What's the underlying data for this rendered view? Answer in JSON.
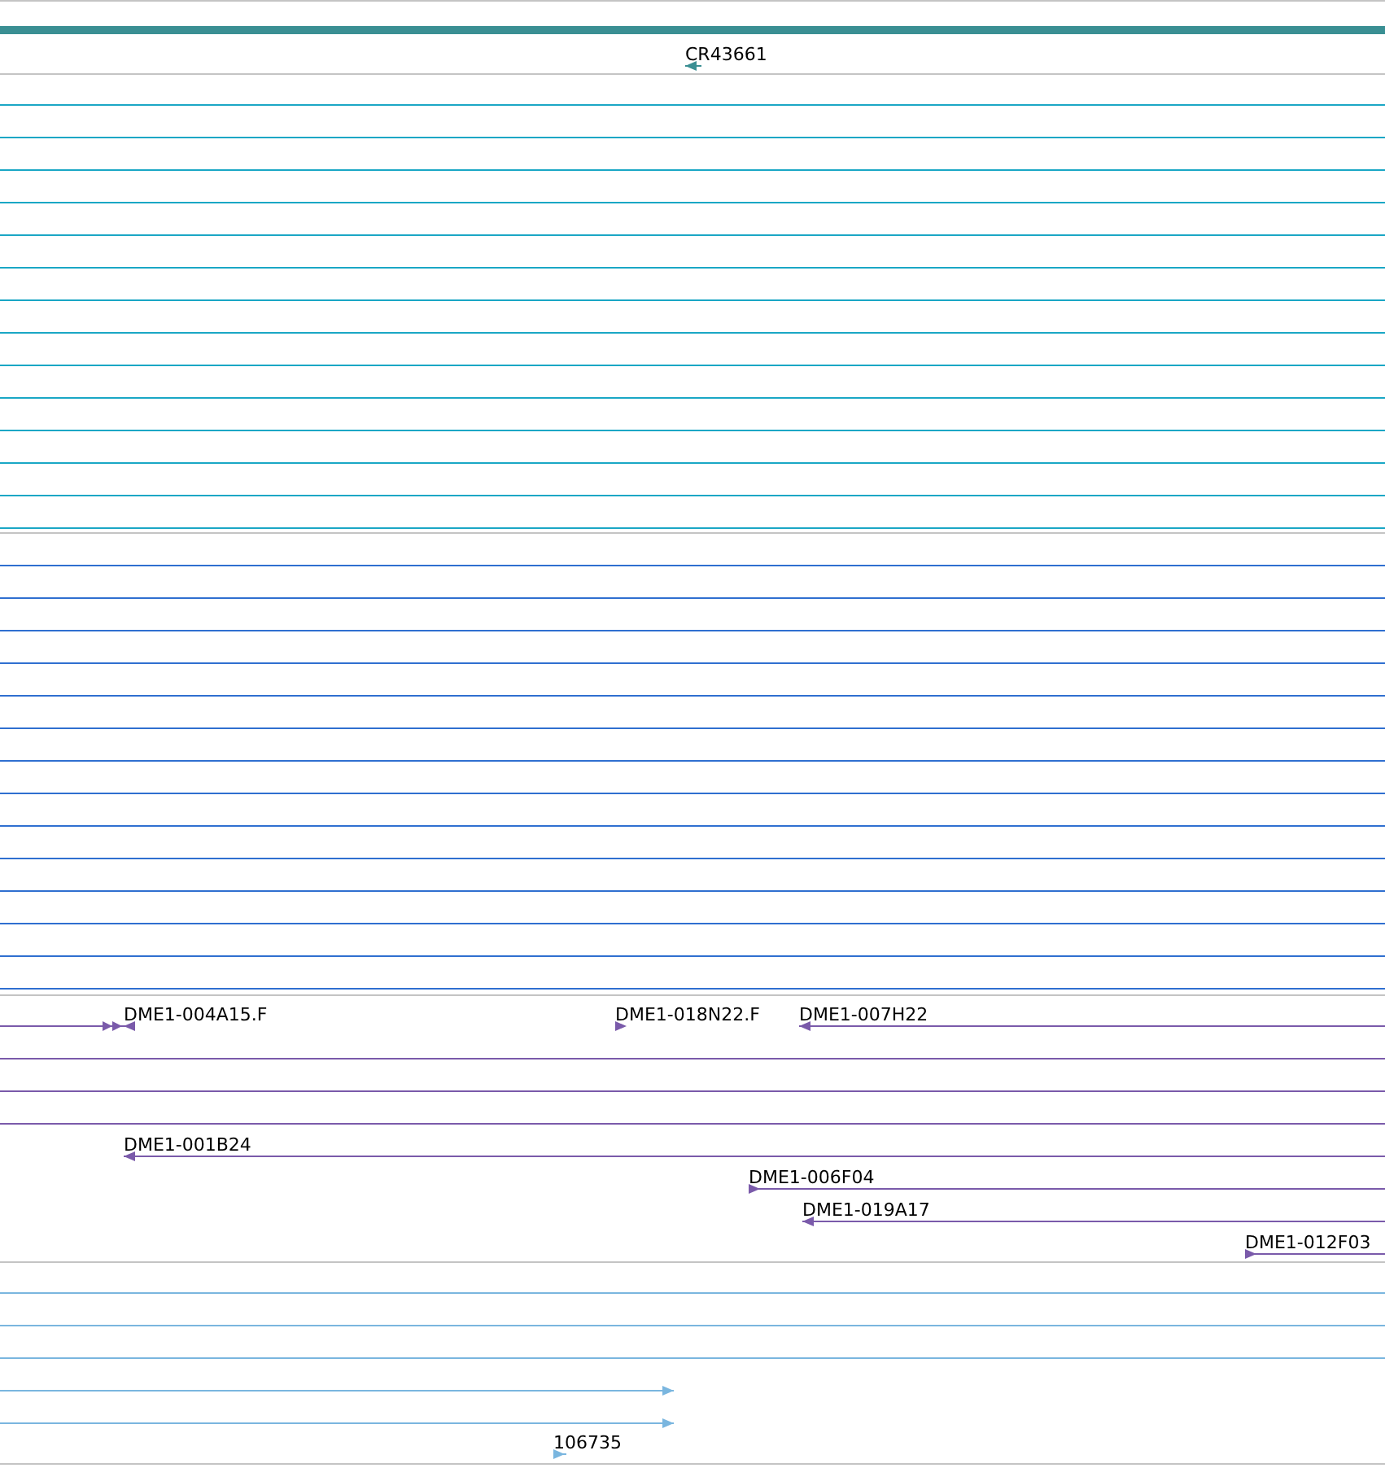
{
  "gene_track": {
    "labels": [
      "CR43661"
    ]
  },
  "clone_track": {
    "labels": [
      "DME1-004A15.F",
      "DME1-018N22.F",
      "DME1-007H22",
      "DME1-001B24",
      "DME1-006F04",
      "DME1-019A17",
      "DME1-012F03"
    ]
  },
  "est_track": {
    "labels": [
      "106735"
    ]
  }
}
